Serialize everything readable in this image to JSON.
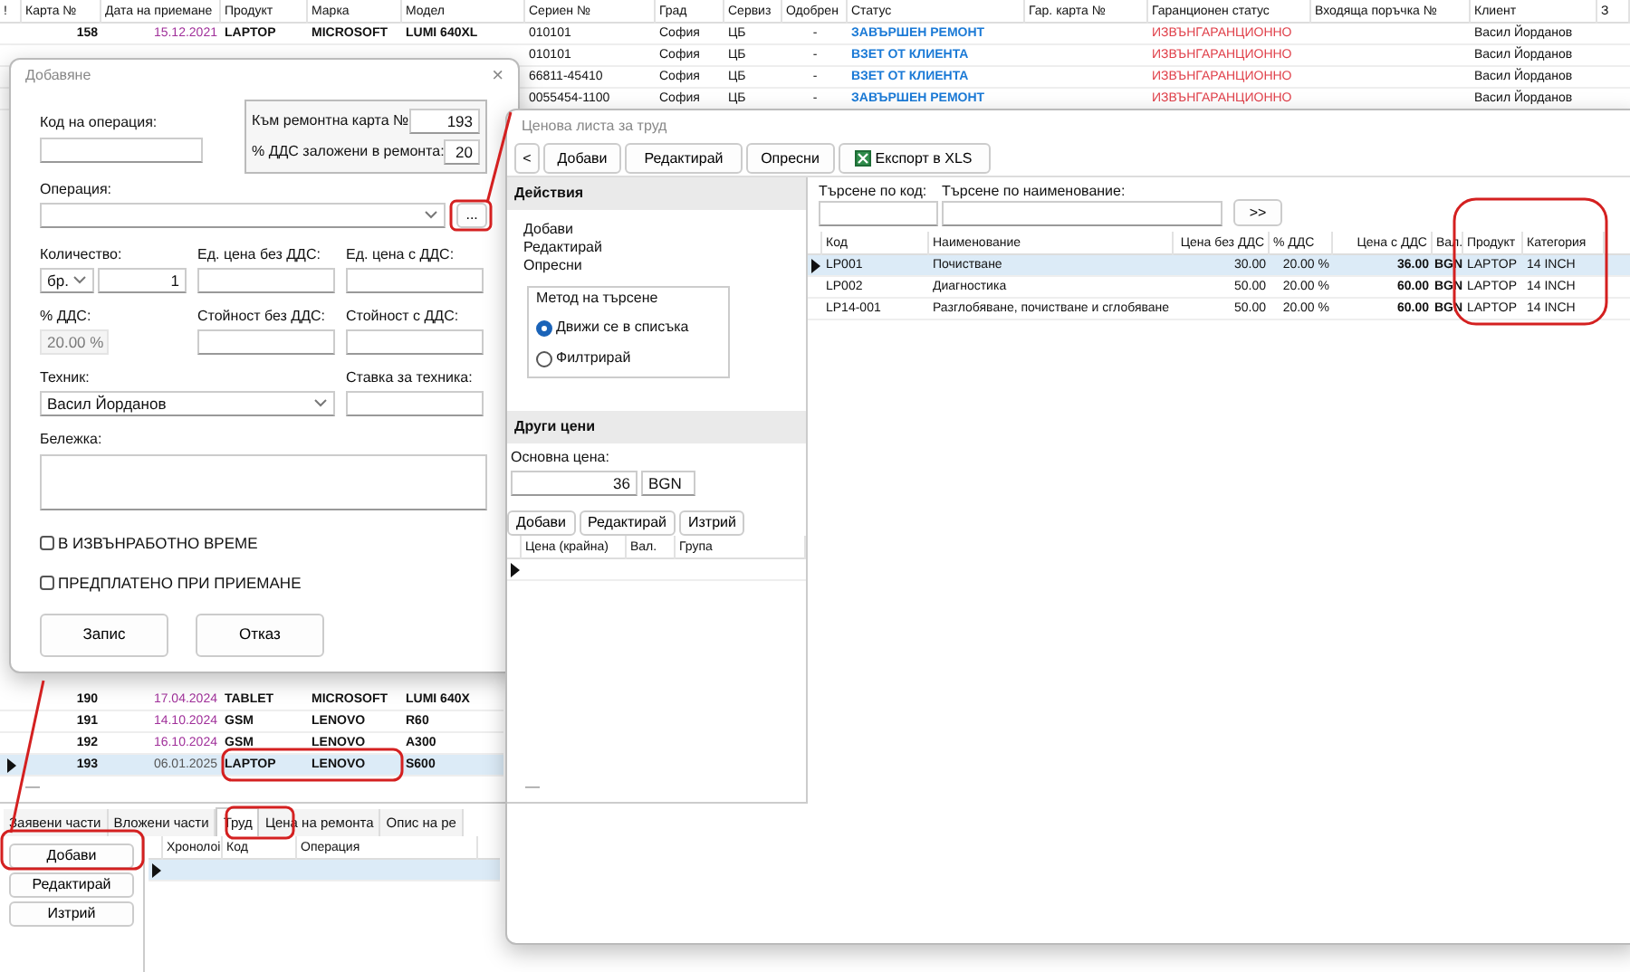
{
  "grid": {
    "columns": [
      "!",
      "Карта №",
      "Дата на приемане",
      "Продукт",
      "Марка",
      "Модел",
      "Сериен №",
      "Град",
      "Сервиз",
      "Одобрен",
      "Статус",
      "Гар. карта №",
      "Гаранционен статус",
      "Входяща поръчка №",
      "Клиент",
      "З"
    ],
    "top_rows": [
      {
        "cells": [
          null,
          "158",
          "15.12.2021",
          "LAPTOP",
          "MICROSOFT",
          "LUMI 640XL",
          "010101",
          "София",
          "ЦБ",
          "-",
          "ЗАВЪРШЕН РЕМОНТ",
          null,
          "ИЗВЪНГАРАНЦИОННО",
          null,
          "Васил Йорданов",
          null
        ],
        "color": "#a0309a",
        "selected": false
      },
      {
        "cells": [
          null,
          null,
          null,
          null,
          null,
          null,
          "010101",
          "София",
          "ЦБ",
          "-",
          "ВЗЕТ ОТ КЛИЕНТА",
          null,
          "ИЗВЪНГАРАНЦИОННО",
          null,
          "Васил Йорданов",
          null
        ],
        "selected": false
      },
      {
        "cells": [
          null,
          null,
          null,
          null,
          null,
          null,
          "66811-45410",
          "София",
          "ЦБ",
          "-",
          "ВЗЕТ ОТ КЛИЕНТА",
          null,
          "ИЗВЪНГАРАНЦИОННО",
          null,
          "Васил Йорданов",
          null
        ],
        "selected": false
      },
      {
        "cells": [
          null,
          null,
          null,
          null,
          null,
          null,
          "0055454-1100",
          "София",
          "ЦБ",
          "-",
          "ЗАВЪРШЕН РЕМОНТ",
          null,
          "ИЗВЪНГАРАНЦИОННО",
          null,
          "Васил Йорданов",
          null
        ],
        "selected": false
      }
    ],
    "bottom_rows": [
      {
        "cells": [
          null,
          "190",
          "17.04.2024",
          "TABLET",
          "MICROSOFT",
          "LUMI 640X"
        ],
        "color": "#a0309a",
        "selected": false
      },
      {
        "cells": [
          null,
          "191",
          "14.10.2024",
          "GSM",
          "LENOVO",
          "R60"
        ],
        "color": "#a0309a",
        "selected": false
      },
      {
        "cells": [
          null,
          "192",
          "16.10.2024",
          "GSM",
          "LENOVO",
          "A300"
        ],
        "color": "#a0309a",
        "selected": false
      },
      {
        "cells": [
          null,
          "193",
          "06.01.2025",
          "LAPTOP",
          "LENOVO",
          "S600"
        ],
        "color": "#555555",
        "selected": true
      }
    ],
    "splitter": "—"
  },
  "tabs": [
    {
      "label": "Заявени части",
      "selected": false
    },
    {
      "label": "Вложени части",
      "selected": false
    },
    {
      "label": "Труд",
      "selected": true
    },
    {
      "label": "Цена на ремонта",
      "selected": false
    },
    {
      "label": "Опис на ре",
      "selected": false
    }
  ],
  "side_buttons": [
    "Добави",
    "Редактирай",
    "Изтрий"
  ],
  "detail_grid": {
    "columns": [
      "Хронолоі",
      "Код",
      "Операция"
    ],
    "rows": [
      {
        "selected": true
      }
    ]
  },
  "add_dialog": {
    "title": "Добавяне",
    "close": "×",
    "operation_code": {
      "label": "Код на операция:"
    },
    "repair_card": {
      "label": "Към ремонтна карта №",
      "value": "193"
    },
    "repair_vat": {
      "label": "% ДДС заложени в ремонта:",
      "value": "20"
    },
    "operation": {
      "label": "Операция:",
      "browse": "..."
    },
    "quantity": {
      "label": "Количество:",
      "unit": "бр.",
      "value": "1"
    },
    "unit_price": {
      "label": "Ед. цена без ДДС:"
    },
    "unit_price_vat": {
      "label": "Ед. цена с ДДС:"
    },
    "vat": {
      "label": "% ДДС:",
      "value": "20.00 %",
      "disabled": true
    },
    "total": {
      "label": "Стойност без ДДС:"
    },
    "total_vat": {
      "label": "Стойност с ДДС:"
    },
    "technician": {
      "label": "Техник:",
      "value": "Васил Йорданов"
    },
    "rate": {
      "label": "Ставка за техника:"
    },
    "note": {
      "label": "Бележка:"
    },
    "checkboxes": [
      {
        "label": "В ИЗВЪНРАБОТНО ВРЕМЕ",
        "checked": false
      },
      {
        "label": "ПРЕДПЛАТЕНО ПРИ ПРИЕМАНЕ",
        "checked": false
      }
    ],
    "buttons": [
      "Запис",
      "Отказ"
    ]
  },
  "price_window": {
    "title": "Ценова листа за труд",
    "toolbar": [
      {
        "label": "<",
        "kind": "plain"
      },
      {
        "label": "Добави",
        "kind": "plain"
      },
      {
        "label": "Редактирай",
        "kind": "plain"
      },
      {
        "label": "Опресни",
        "kind": "plain"
      },
      {
        "label": "Експорт в XLS",
        "kind": "excel"
      }
    ],
    "actions": {
      "title": "Действия",
      "links": [
        "Добави",
        "Редактирай",
        "Опресни"
      ],
      "search_method": {
        "title": "Метод на търсене",
        "options": [
          {
            "label": "Движи се в списъка",
            "selected": true
          },
          {
            "label": "Филтрирай",
            "selected": false
          }
        ]
      }
    },
    "other_prices": {
      "title": "Други цени",
      "base_label": "Основна цена:",
      "base_value": "36",
      "currency": "BGN",
      "buttons": [
        "Добави",
        "Редактирай",
        "Изтрий"
      ],
      "columns": [
        "Цена (крайна)",
        "Вал.",
        "Група"
      ],
      "rows": [
        {
          "selected": true
        }
      ]
    },
    "splitter": "—",
    "search": {
      "code_label": "Търсене по код:",
      "name_label": "Търсене по наименование:",
      "go": ">>"
    },
    "table": {
      "columns": [
        "Код",
        "Наименование",
        "Цена без ДДС",
        "% ДДС",
        "Цена с ДДС",
        "Вал.",
        "Продукт",
        "Категория"
      ],
      "rows": [
        {
          "cells": [
            "LP001",
            "Почистване",
            "30.00",
            "20.00 %",
            "36.00",
            "BGN",
            "LAPTOP",
            "14 INCH"
          ],
          "selected": true
        },
        {
          "cells": [
            "LP002",
            "Диагностика",
            "50.00",
            "20.00 %",
            "60.00",
            "BGN",
            "LAPTOP",
            "14 INCH"
          ],
          "selected": false
        },
        {
          "cells": [
            "LP14-001",
            "Разглобяване, почистване и сглобяване",
            "50.00",
            "20.00 %",
            "60.00",
            "BGN",
            "LAPTOP",
            "14 INCH"
          ],
          "selected": false
        }
      ]
    }
  }
}
